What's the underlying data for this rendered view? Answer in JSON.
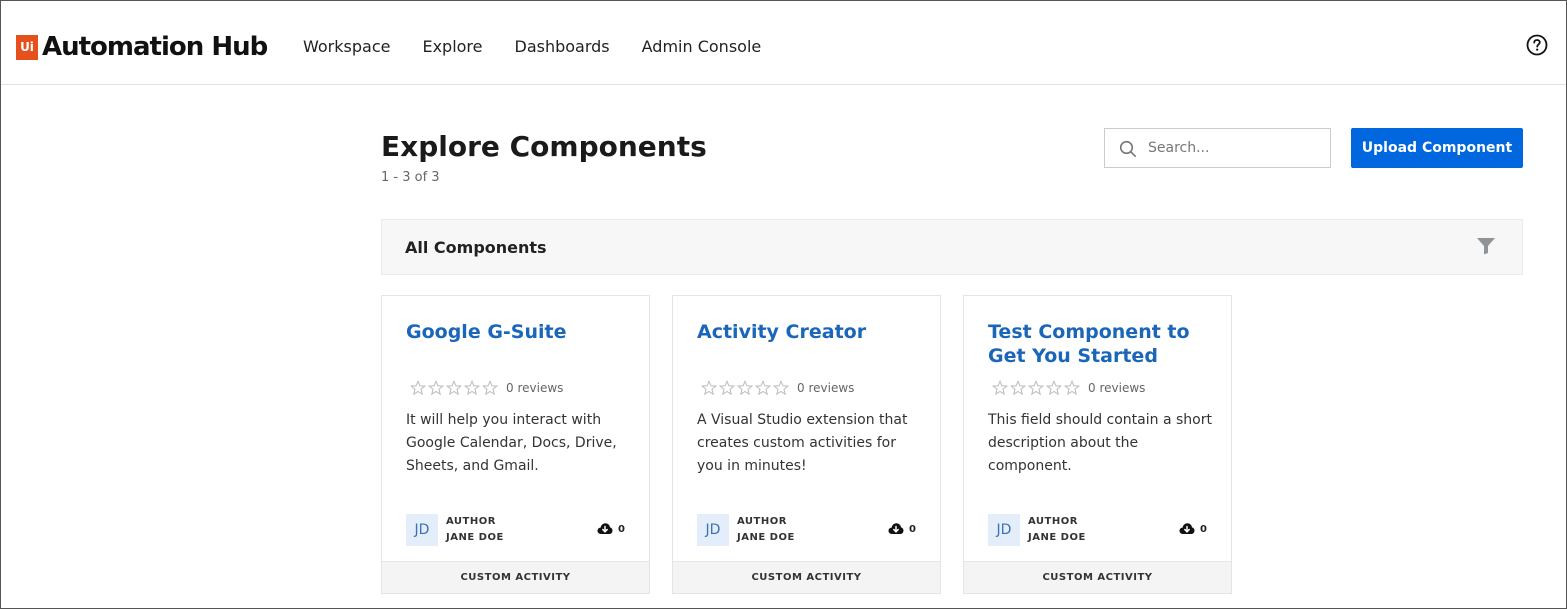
{
  "app": {
    "logo_badge": "Ui",
    "logo_text": "Automation Hub",
    "brand_color": "#e5501c",
    "accent_color": "#0067df"
  },
  "nav": {
    "items": [
      {
        "label": "Workspace"
      },
      {
        "label": "Explore"
      },
      {
        "label": "Dashboards"
      },
      {
        "label": "Admin Console"
      }
    ],
    "help_icon": "question-circle-icon"
  },
  "page": {
    "title": "Explore Components",
    "count": "1 - 3 of 3"
  },
  "search": {
    "placeholder": "Search...",
    "value": ""
  },
  "toolbar": {
    "upload_label": "Upload Component"
  },
  "filter": {
    "label": "All Components",
    "icon": "filter-icon"
  },
  "cards": [
    {
      "title": "Google G-Suite",
      "reviews": "0 reviews",
      "description": "It will help you interact with Google Calendar, Docs, Drive, Sheets, and Gmail.",
      "avatar": "JD",
      "author_label": "AUTHOR",
      "author_name": "JANE DOE",
      "downloads": "0",
      "type": "CUSTOM ACTIVITY"
    },
    {
      "title": "Activity Creator",
      "reviews": "0 reviews",
      "description": "A Visual Studio extension that creates custom activities for you in minutes!",
      "avatar": "JD",
      "author_label": "AUTHOR",
      "author_name": "JANE DOE",
      "downloads": "0",
      "type": "CUSTOM ACTIVITY"
    },
    {
      "title": "Test Component to Get You Started",
      "reviews": "0 reviews",
      "description": "This field should contain a short description about the component.",
      "avatar": "JD",
      "author_label": "AUTHOR",
      "author_name": "JANE DOE",
      "downloads": "0",
      "type": "CUSTOM ACTIVITY"
    }
  ]
}
